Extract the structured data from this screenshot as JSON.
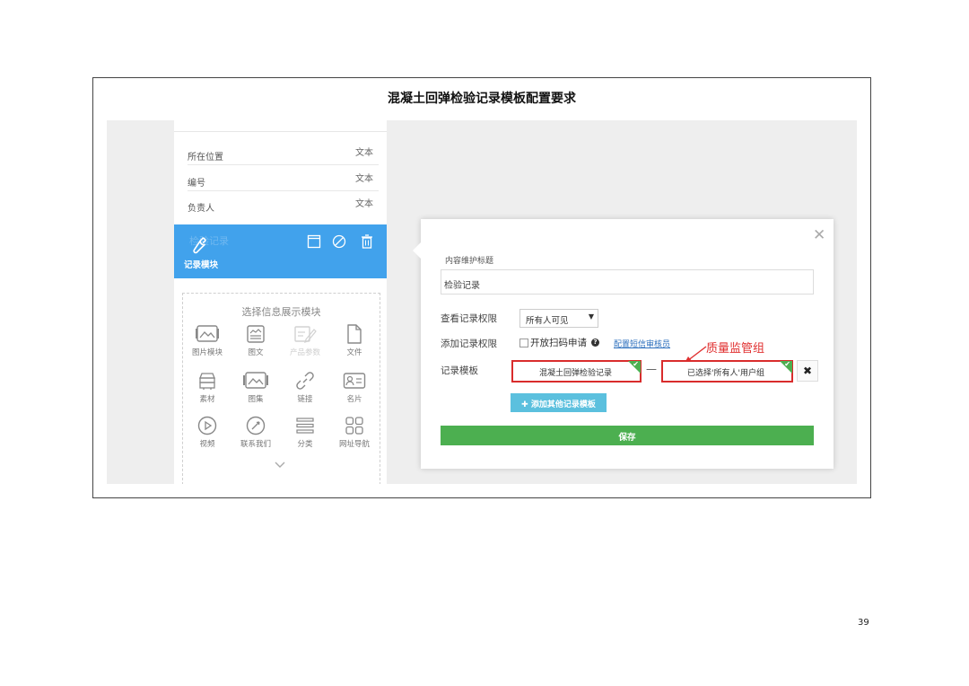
{
  "doc_title": "混凝土回弹检验记录模板配置要求",
  "page_number": "39",
  "left_panel": {
    "fields": [
      {
        "name": "所在位置",
        "type": "文本"
      },
      {
        "name": "编号",
        "type": "文本"
      },
      {
        "name": "负责人",
        "type": "文本"
      }
    ],
    "selected_block": {
      "ghost_label": "检验记录",
      "label": "记录模块",
      "icon": "wrench-icon",
      "actions": [
        "window-icon",
        "ban-icon",
        "trash-icon"
      ]
    },
    "chooser": {
      "title": "选择信息展示模块",
      "modules": [
        {
          "label": "图片模块",
          "icon": "image-icon"
        },
        {
          "label": "图文",
          "icon": "image-text-icon"
        },
        {
          "label": "产品参数",
          "icon": "edit-doc-icon"
        },
        {
          "label": "文件",
          "icon": "file-icon"
        },
        {
          "label": "素材",
          "icon": "stack-icon"
        },
        {
          "label": "图集",
          "icon": "gallery-icon"
        },
        {
          "label": "链接",
          "icon": "link-icon"
        },
        {
          "label": "名片",
          "icon": "card-icon"
        },
        {
          "label": "视频",
          "icon": "play-icon"
        },
        {
          "label": "联系我们",
          "icon": "compass-icon"
        },
        {
          "label": "分类",
          "icon": "menu-icon"
        },
        {
          "label": "网址导航",
          "icon": "grid-icon"
        }
      ]
    }
  },
  "dialog": {
    "title_label": "内容维护标题",
    "title_value": "检验记录",
    "view_permission_label": "查看记录权限",
    "view_permission_value": "所有人可见",
    "add_permission_label": "添加记录权限",
    "scan_apply_label": "开放扫码申请",
    "scan_apply_checked": false,
    "config_link": "配置短信审核员",
    "annotation": "质量监管组",
    "template_label": "记录模板",
    "template_value": "混凝土回弹检验记录",
    "template_dash": "—",
    "user_group_value": "已选择'所有人'用户组",
    "add_template_button": "✚ 添加其他记录模板",
    "save_button": "保存",
    "colors": {
      "annotation": "#e03030",
      "save": "#4caf50",
      "add": "#5bc0de",
      "selected": "#41a2ec"
    }
  }
}
